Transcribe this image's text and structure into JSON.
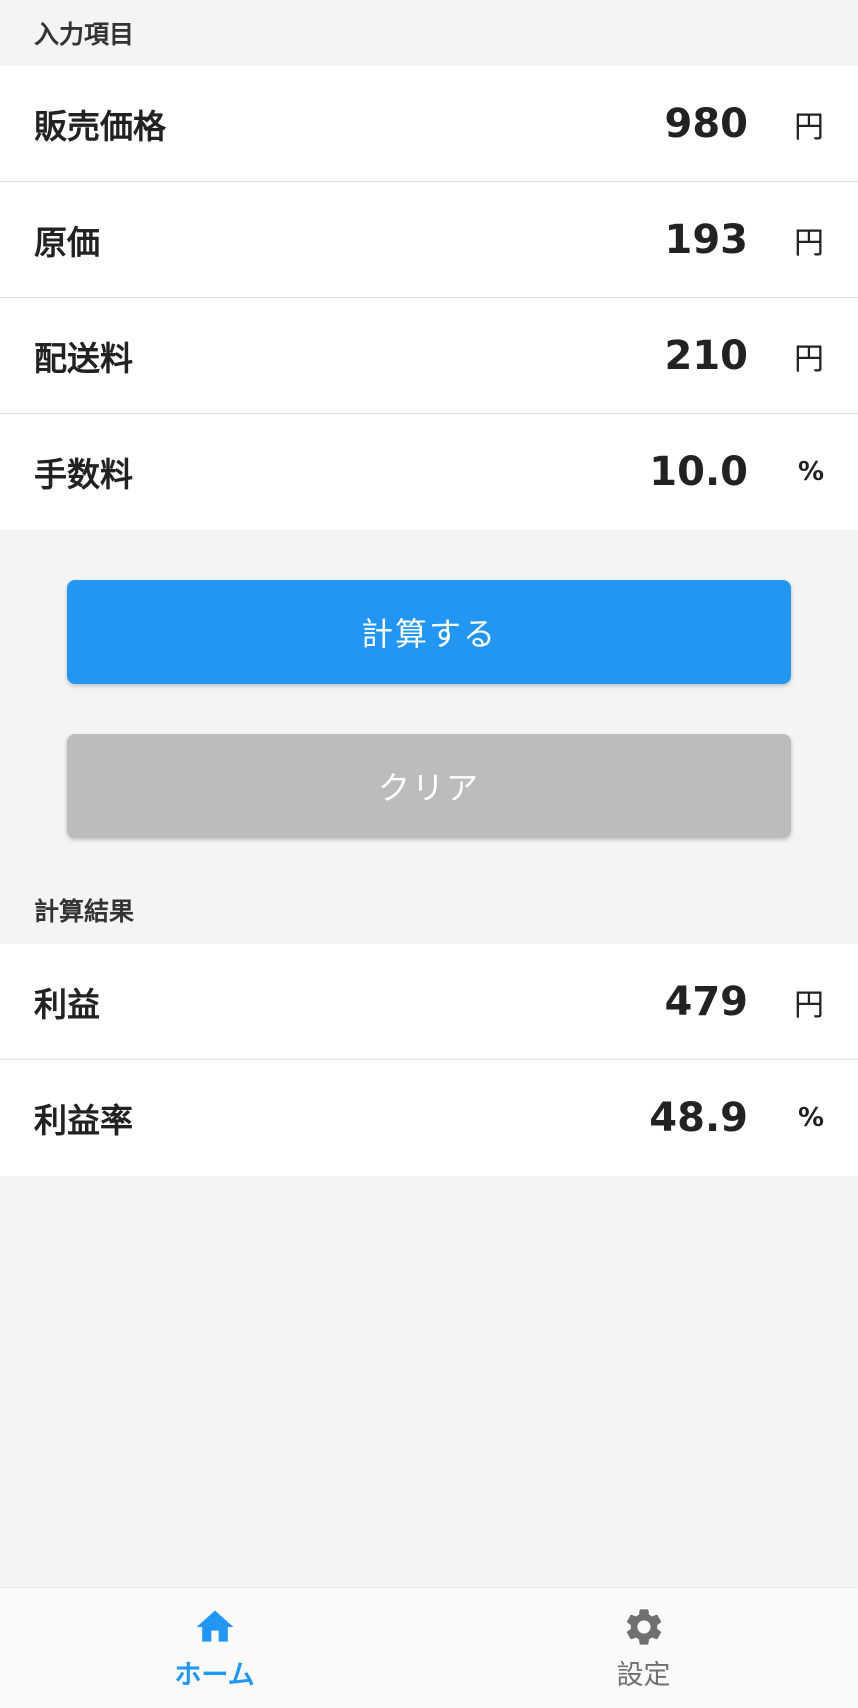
{
  "colors": {
    "accent": "#2196f3",
    "clear_button": "#bcbcbc",
    "background": "#f4f4f4",
    "nav_inactive": "#707070"
  },
  "inputs_section": {
    "title": "入力項目",
    "rows": [
      {
        "label": "販売価格",
        "value": "980",
        "unit": "円"
      },
      {
        "label": "原価",
        "value": "193",
        "unit": "円"
      },
      {
        "label": "配送料",
        "value": "210",
        "unit": "円"
      },
      {
        "label": "手数料",
        "value": "10.0",
        "unit": "%"
      }
    ]
  },
  "buttons": {
    "calculate_label": "計算する",
    "clear_label": "クリア"
  },
  "results_section": {
    "title": "計算結果",
    "rows": [
      {
        "label": "利益",
        "value": "479",
        "unit": "円"
      },
      {
        "label": "利益率",
        "value": "48.9",
        "unit": "%"
      }
    ]
  },
  "bottom_nav": {
    "items": [
      {
        "label": "ホーム",
        "icon": "home-icon",
        "active": true
      },
      {
        "label": "設定",
        "icon": "gear-icon",
        "active": false
      }
    ]
  }
}
